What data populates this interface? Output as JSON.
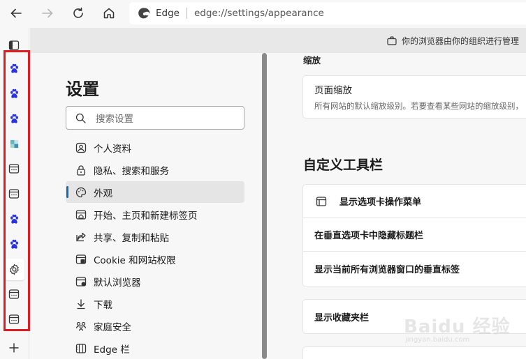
{
  "browser": {
    "brand": "Edge",
    "url": "edge://settings/appearance",
    "managed_notice": "你的浏览器由你的组织进行管理"
  },
  "vertical_tabs": {
    "tab_icons": [
      "baidu-paw-icon",
      "baidu-paw-icon",
      "baidu-paw-icon",
      "colorful-app-icon",
      "generic-page-icon",
      "generic-page-icon",
      "baidu-paw-icon",
      "baidu-paw-icon",
      "settings-gear-icon",
      "generic-page-icon",
      "generic-page-icon"
    ],
    "active_tab": 8,
    "highlight_color": "#e01b22"
  },
  "settings_nav": {
    "title": "设置",
    "search_placeholder": "搜索设置",
    "items": [
      {
        "label": "个人资料",
        "icon": "profile-icon"
      },
      {
        "label": "隐私、搜索和服务",
        "icon": "lock-icon"
      },
      {
        "label": "外观",
        "icon": "palette-icon",
        "selected": true
      },
      {
        "label": "开始、主页和新建标签页",
        "icon": "home-tabs-icon"
      },
      {
        "label": "共享、复制和粘贴",
        "icon": "share-icon"
      },
      {
        "label": "Cookie 和网站权限",
        "icon": "site-permissions-icon"
      },
      {
        "label": "默认浏览器",
        "icon": "default-browser-icon"
      },
      {
        "label": "下载",
        "icon": "download-icon"
      },
      {
        "label": "家庭安全",
        "icon": "family-icon"
      },
      {
        "label": "Edge 栏",
        "icon": "edge-bar-icon"
      }
    ]
  },
  "content": {
    "zoom_section": "缩放",
    "page_zoom": {
      "title": "页面缩放",
      "description": "所有网站的默认缩放级别。若要查看某些网站的缩放级别，"
    },
    "toolbar_section": "自定义工具栏",
    "toolbar_rows": [
      {
        "label": "显示选项卡操作菜单",
        "icon": "tab-actions-icon"
      },
      {
        "label": "在垂直选项卡中隐藏标题栏"
      },
      {
        "label": "显示当前所有浏览器窗口的垂直标签"
      }
    ],
    "favorites_row": "显示收藏夹栏"
  },
  "watermark": {
    "main": "Baidu 经验",
    "sub": "jingyan.baidu.com"
  },
  "colors": {
    "accent": "#0f6cbd",
    "baidu_blue": "#2932e1"
  }
}
